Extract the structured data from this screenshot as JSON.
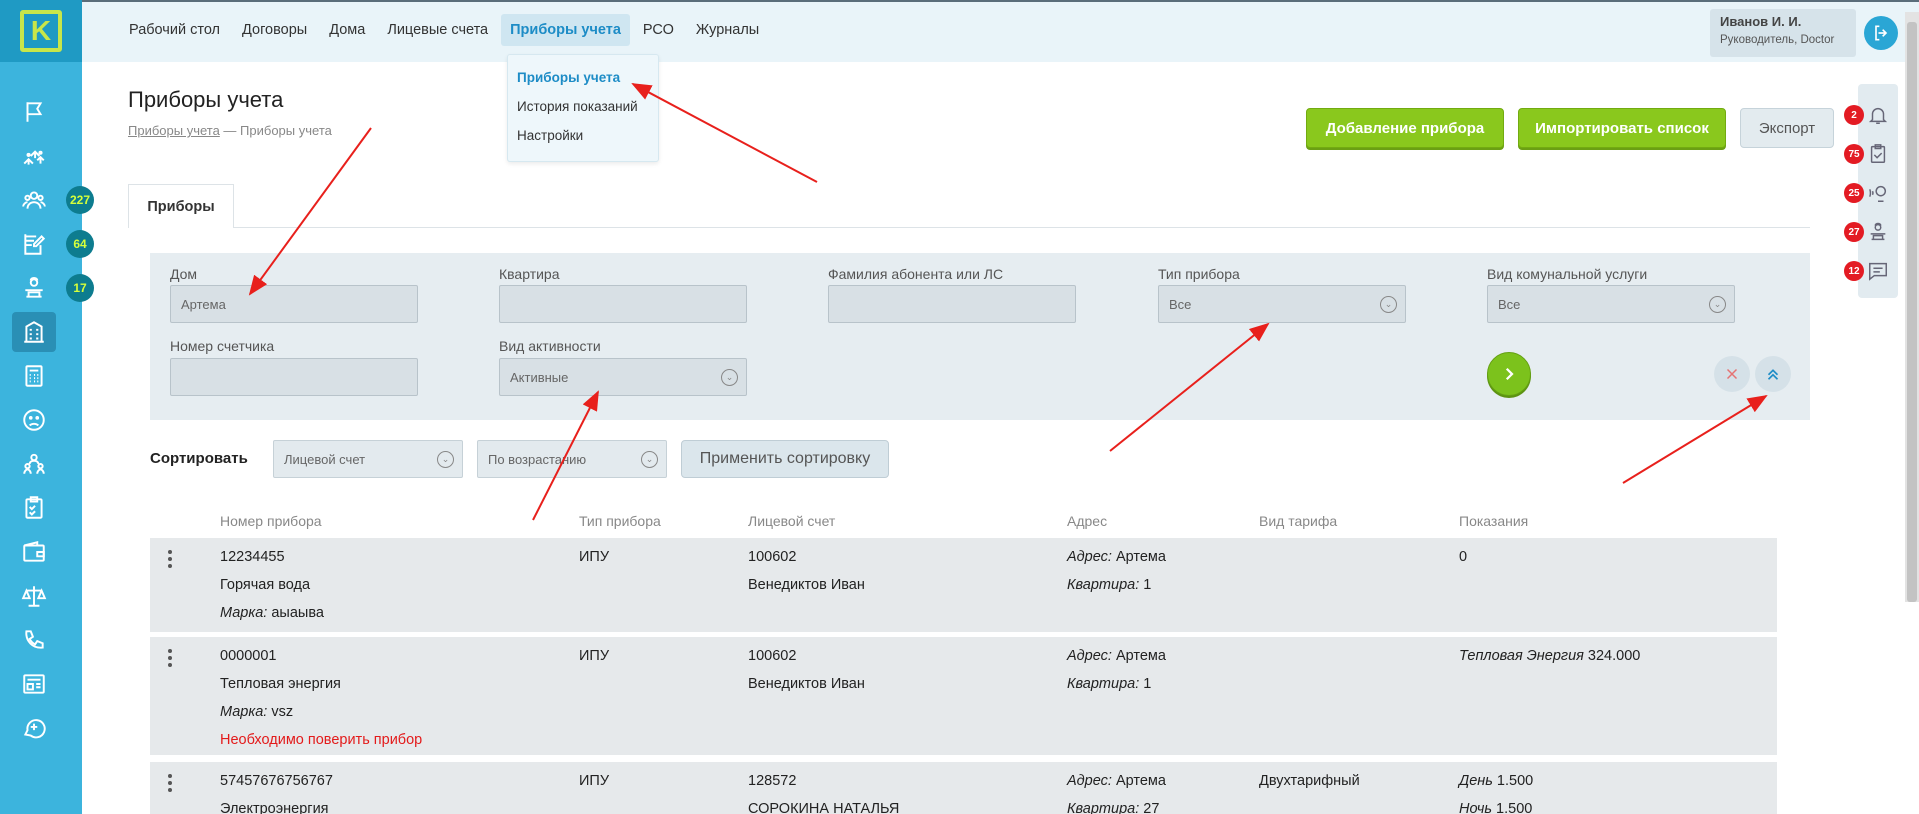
{
  "sidebar": {
    "logo_letter": "K",
    "items": [
      {
        "icon": "flag-icon",
        "badge": ""
      },
      {
        "icon": "houses-icon",
        "badge": ""
      },
      {
        "icon": "people-group-icon",
        "badge": "227"
      },
      {
        "icon": "edit-document-icon",
        "badge": "64"
      },
      {
        "icon": "dispatcher-icon",
        "badge": "17"
      },
      {
        "icon": "building-icon",
        "badge": "",
        "active": true
      },
      {
        "icon": "calculator-icon",
        "badge": ""
      },
      {
        "icon": "sad-face-icon",
        "badge": ""
      },
      {
        "icon": "team-icon",
        "badge": ""
      },
      {
        "icon": "checklist-icon",
        "badge": ""
      },
      {
        "icon": "wallet-icon",
        "badge": ""
      },
      {
        "icon": "scales-icon",
        "badge": ""
      },
      {
        "icon": "phone-icon",
        "badge": ""
      },
      {
        "icon": "newspaper-icon",
        "badge": ""
      },
      {
        "icon": "chat-plus-icon",
        "badge": ""
      }
    ]
  },
  "topnav": {
    "items": [
      "Рабочий стол",
      "Договоры",
      "Дома",
      "Лицевые счета",
      "Приборы учета",
      "РСО",
      "Журналы"
    ],
    "active": "Приборы учета"
  },
  "dropdown": {
    "items": [
      "Приборы учета",
      "История показаний",
      "Настройки"
    ]
  },
  "user": {
    "name": "Иванов И. И.",
    "role": "Руководитель, Doctor"
  },
  "page": {
    "title": "Приборы учета",
    "breadcrumb_link": "Приборы учета",
    "breadcrumb_sep": " — ",
    "breadcrumb_current": "Приборы учета"
  },
  "actions": {
    "add": "Добавление прибора",
    "import": "Импортировать список",
    "export": "Экспорт"
  },
  "notifications": [
    {
      "icon": "bell-icon",
      "count": "2"
    },
    {
      "icon": "clipboard-check-icon",
      "count": "75"
    },
    {
      "icon": "operator-voice-icon",
      "count": "25"
    },
    {
      "icon": "dispatcher-icon",
      "count": "27"
    },
    {
      "icon": "message-icon",
      "count": "12"
    }
  ],
  "tabs": [
    "Приборы"
  ],
  "filters": {
    "house": {
      "label": "Дом",
      "value": "Артема"
    },
    "apartment": {
      "label": "Квартира",
      "value": ""
    },
    "surname": {
      "label": "Фамилия абонента или ЛС",
      "value": ""
    },
    "device_type": {
      "label": "Тип прибора",
      "value": "Все"
    },
    "service": {
      "label": "Вид комунальной услуги",
      "value": "Все"
    },
    "meter_number": {
      "label": "Номер счетчика",
      "value": ""
    },
    "activity": {
      "label": "Вид активности",
      "value": "Активные"
    }
  },
  "sort": {
    "label": "Сортировать",
    "field": "Лицевой счет",
    "order": "По возрастанию",
    "apply": "Применить сортировку"
  },
  "table": {
    "headers": [
      "Номер прибора",
      "Тип прибора",
      "Лицевой счет",
      "Адрес",
      "Вид тарифа",
      "Показания"
    ],
    "address_label": "Адрес:",
    "apartment_label": "Квартира:",
    "brand_label": "Марка:",
    "rows": [
      {
        "number": "12234455",
        "resource": "Горячая вода",
        "brand": "аыаыва",
        "warning": "",
        "type": "ИПУ",
        "account": "100602",
        "owner": "Венедиктов Иван",
        "address": "Артема",
        "apartment": "1",
        "tariff": "",
        "readings": [
          {
            "label": "",
            "value": "0"
          }
        ]
      },
      {
        "number": "0000001",
        "resource": "Тепловая энергия",
        "brand": "vsz",
        "warning": "Необходимо поверить прибор",
        "type": "ИПУ",
        "account": "100602",
        "owner": "Венедиктов Иван",
        "address": "Артема",
        "apartment": "1",
        "tariff": "",
        "readings": [
          {
            "label": "Тепловая Энергия",
            "value": "324.000"
          }
        ]
      },
      {
        "number": "57457676756767",
        "resource": "Электроэнергия",
        "brand": "",
        "warning": "",
        "type": "ИПУ",
        "account": "128572",
        "owner": "СОРОКИНА НАТАЛЬЯ",
        "address": "Артема",
        "apartment": "27",
        "tariff": "Двухтарифный",
        "readings": [
          {
            "label": "День",
            "value": "1.500"
          },
          {
            "label": "Ночь",
            "value": "1.500"
          }
        ]
      }
    ]
  },
  "colors": {
    "sidebar": "#3cb4dd",
    "topbar": "#e9f4f9",
    "accent_green": "#8ac81d",
    "link_blue": "#1d8cc6",
    "badge_red": "#e31b23",
    "annotation_red": "#e8201c"
  }
}
